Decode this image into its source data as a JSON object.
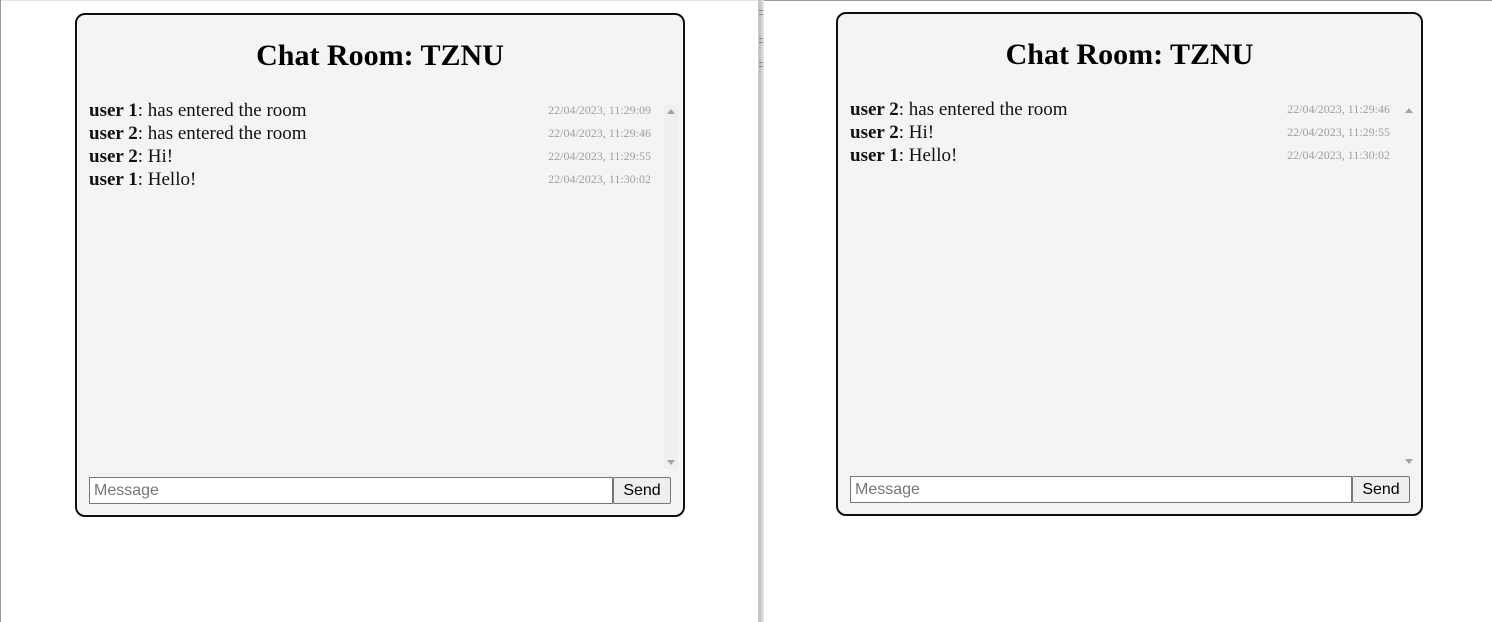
{
  "windows": [
    {
      "room_title": "Chat Room: TZNU",
      "messages": [
        {
          "user": "user 1",
          "text": ": has entered the room",
          "time": "22/04/2023, 11:29:09"
        },
        {
          "user": "user 2",
          "text": ": has entered the room",
          "time": "22/04/2023, 11:29:46"
        },
        {
          "user": "user 2",
          "text": ": Hi!",
          "time": "22/04/2023, 11:29:55"
        },
        {
          "user": "user 1",
          "text": ": Hello!",
          "time": "22/04/2023, 11:30:02"
        }
      ],
      "composer": {
        "placeholder": "Message",
        "value": "",
        "send_label": "Send"
      },
      "icons": {
        "scroll_up": "scroll-up-arrow-icon",
        "scroll_down": "scroll-down-arrow-icon"
      }
    },
    {
      "room_title": "Chat Room: TZNU",
      "messages": [
        {
          "user": "user 2",
          "text": ": has entered the room",
          "time": "22/04/2023, 11:29:46"
        },
        {
          "user": "user 2",
          "text": ": Hi!",
          "time": "22/04/2023, 11:29:55"
        },
        {
          "user": "user 1",
          "text": ": Hello!",
          "time": "22/04/2023, 11:30:02"
        }
      ],
      "composer": {
        "placeholder": "Message",
        "value": "",
        "send_label": "Send"
      },
      "icons": {
        "scroll_up": "scroll-up-arrow-icon",
        "scroll_down": "scroll-down-arrow-icon"
      }
    }
  ],
  "colors": {
    "chat_background": "#f4f4f4",
    "border": "#111111",
    "timestamp": "#a0a0a0"
  }
}
